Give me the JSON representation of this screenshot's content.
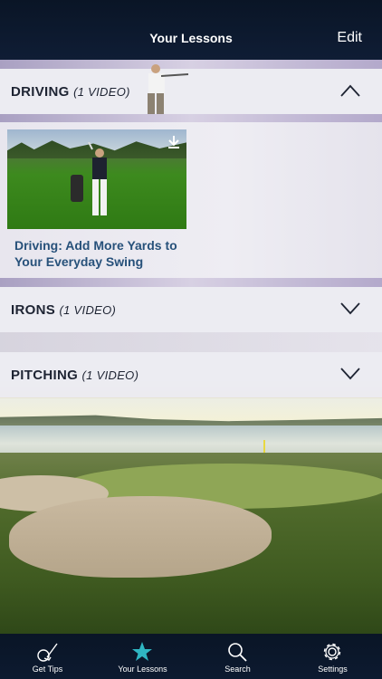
{
  "header": {
    "title": "Your Lessons",
    "edit_label": "Edit"
  },
  "sections": [
    {
      "name": "DRIVING",
      "count": "(1 VIDEO)",
      "expanded": true
    },
    {
      "name": "IRONS",
      "count": "(1 VIDEO)",
      "expanded": false
    },
    {
      "name": "PITCHING",
      "count": "(1 VIDEO)",
      "expanded": false
    }
  ],
  "lesson": {
    "title": "Driving: Add More Yards to Your Everyday Swing"
  },
  "tabs": [
    {
      "label": "Get Tips",
      "icon": "golf-club-ball-icon"
    },
    {
      "label": "Your Lessons",
      "icon": "star-icon",
      "active": true
    },
    {
      "label": "Search",
      "icon": "search-icon"
    },
    {
      "label": "Settings",
      "icon": "gear-icon"
    }
  ],
  "colors": {
    "accent": "#2fb6c2",
    "header_bg": "#0d1a2e",
    "lesson_title": "#27517a"
  }
}
